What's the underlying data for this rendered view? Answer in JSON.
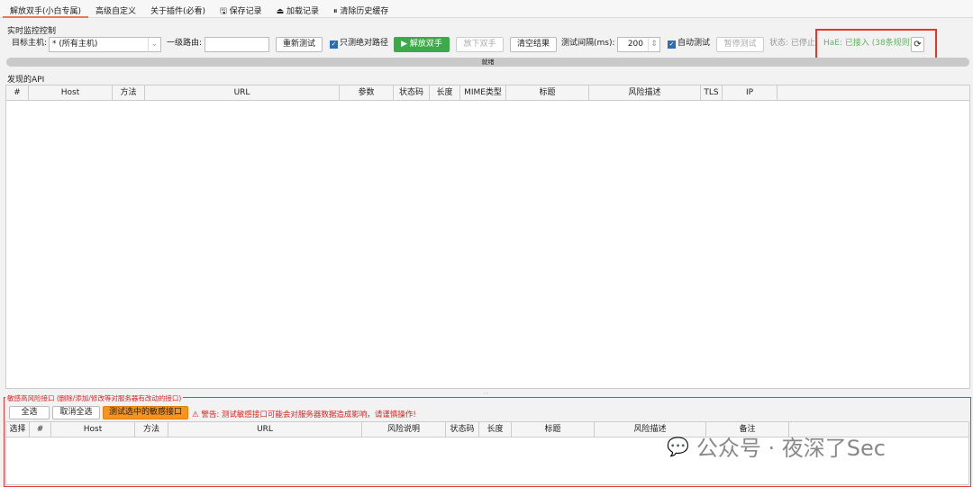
{
  "tabs": [
    "解放双手(小白专属)",
    "高级自定义",
    "关于插件(必看)",
    "🖫 保存记录",
    "⏏ 加载记录",
    "⏸ 清除历史缓存"
  ],
  "monitor": {
    "title": "实时监控控制",
    "target_label": "目标主机:",
    "target_value": "* (所有主机)",
    "route_label": "一级路由:",
    "route_value": "",
    "retest": "重新测试",
    "abs_path": "只测绝对路径",
    "free_hands": "▶ 解放双手",
    "release": "放下双手",
    "clear": "清空结果",
    "interval_label": "测试间隔(ms):",
    "interval_value": "200",
    "auto_test": "自动测试",
    "pause": "暂停测试",
    "status": "状态: 已停止",
    "hae": "HaE: 已接入 (38条规则)",
    "progress_text": "就绪",
    "accent": "#3daa4a"
  },
  "api": {
    "title": "发现的API",
    "columns": [
      "#",
      "Host",
      "方法",
      "URL",
      "参数",
      "状态码",
      "长度",
      "MIME类型",
      "标题",
      "风险描述",
      "TLS",
      "IP"
    ]
  },
  "sensitive": {
    "title": "敏感高风险接口 (删除/添加/修改等对服务器有改动的接口)",
    "select_all": "全选",
    "deselect_all": "取消全选",
    "test_selected": "测试选中的敏感接口",
    "warning": "⚠ 警告: 测试敏感接口可能会对服务器数据造成影响，请谨慎操作!",
    "columns": [
      "选择",
      "#",
      "Host",
      "方法",
      "URL",
      "风险说明",
      "状态码",
      "长度",
      "标题",
      "风险描述",
      "备注"
    ]
  },
  "watermark": "公众号 · 夜深了Sec"
}
